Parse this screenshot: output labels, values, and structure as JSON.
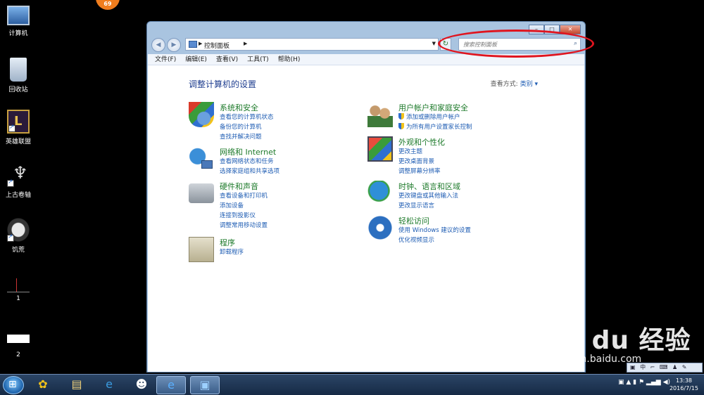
{
  "desktop": {
    "badge": "69",
    "icons": [
      {
        "label": "计算机",
        "icon": "computer-icon"
      },
      {
        "label": "回收站",
        "icon": "recycle-bin-icon"
      },
      {
        "label": "英雄联盟",
        "icon": "league-of-legends-icon"
      },
      {
        "label": "上古卷轴",
        "icon": "skyrim-icon"
      },
      {
        "label": "饥荒",
        "icon": "dont-starve-icon"
      },
      {
        "label": "1",
        "icon": "thumbnail-icon"
      },
      {
        "label": "2",
        "icon": "thumbnail-icon"
      }
    ]
  },
  "window": {
    "address": {
      "crumb": "控制面板"
    },
    "search": {
      "placeholder": "搜索控制面板"
    },
    "menu": [
      "文件(F)",
      "编辑(E)",
      "查看(V)",
      "工具(T)",
      "帮助(H)"
    ],
    "title": "调整计算机的设置",
    "view_by": {
      "label": "查看方式:",
      "value": "类别"
    },
    "categories_left": [
      {
        "title": "系统和安全",
        "icon": "security-shield-icon",
        "links": [
          "查看您的计算机状态",
          "备份您的计算机",
          "查找并解决问题"
        ]
      },
      {
        "title": "网络和 Internet",
        "icon": "network-globe-icon",
        "links": [
          "查看网络状态和任务",
          "选择家庭组和共享选项"
        ]
      },
      {
        "title": "硬件和声音",
        "icon": "printer-icon",
        "links": [
          "查看设备和打印机",
          "添加设备",
          "连接到投影仪",
          "调整常用移动设置"
        ]
      },
      {
        "title": "程序",
        "icon": "programs-icon",
        "links": [
          "卸载程序"
        ]
      }
    ],
    "categories_right": [
      {
        "title": "用户帐户和家庭安全",
        "icon": "users-icon",
        "links": [
          "添加或删除用户帐户",
          "为所有用户设置家长控制"
        ]
      },
      {
        "title": "外观和个性化",
        "icon": "appearance-icon",
        "links": [
          "更改主题",
          "更改桌面背景",
          "调整屏幕分辨率"
        ]
      },
      {
        "title": "时钟、语言和区域",
        "icon": "clock-globe-icon",
        "links": [
          "更改键盘或其他输入法",
          "更改显示语言"
        ]
      },
      {
        "title": "轻松访问",
        "icon": "ease-of-access-icon",
        "links": [
          "使用 Windows 建议的设置",
          "优化视频显示"
        ]
      }
    ]
  },
  "taskbar": {
    "clock_time": "13:38",
    "clock_date": "2016/7/15",
    "ime_label": "中"
  },
  "watermark": {
    "main": "Bai du 经验",
    "sub": "jingyan.baidu.com"
  },
  "colors": {
    "accent": "#1e5cb3",
    "category_title": "#1d7a2a",
    "highlight": "#e0141e"
  }
}
